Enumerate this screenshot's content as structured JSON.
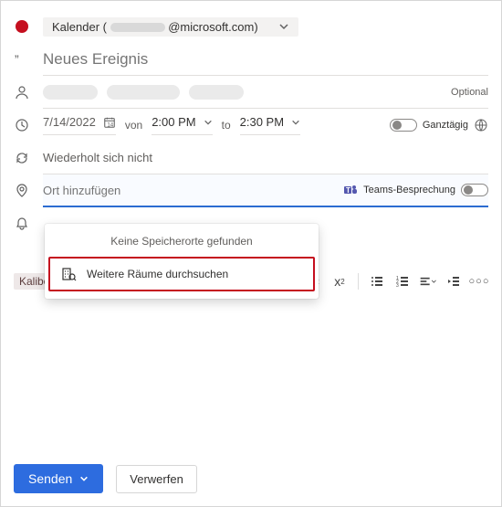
{
  "calendar": {
    "name_prefix": "Kalender (",
    "name_suffix": "@microsoft.com)"
  },
  "title": {
    "placeholder": "Neues Ereignis"
  },
  "attendees": {
    "optional_btn": "Optional"
  },
  "datetime": {
    "date": "7/14/2022",
    "from_label": "von",
    "start_time": "2:00 PM",
    "to_label": "to",
    "end_time": "2:30 PM",
    "allday_label": "Ganztägig"
  },
  "recurrence": {
    "text": "Wiederholt sich nicht"
  },
  "location": {
    "placeholder": "Ort hinzufügen",
    "teams_label": "Teams-Besprechung",
    "popup_msg": "Keine Speicherorte gefunden",
    "popup_action": "Weitere Räume durchsuchen"
  },
  "toolbar": {
    "font_tag": "Kaliber"
  },
  "footer": {
    "send": "Senden",
    "discard": "Verwerfen"
  }
}
